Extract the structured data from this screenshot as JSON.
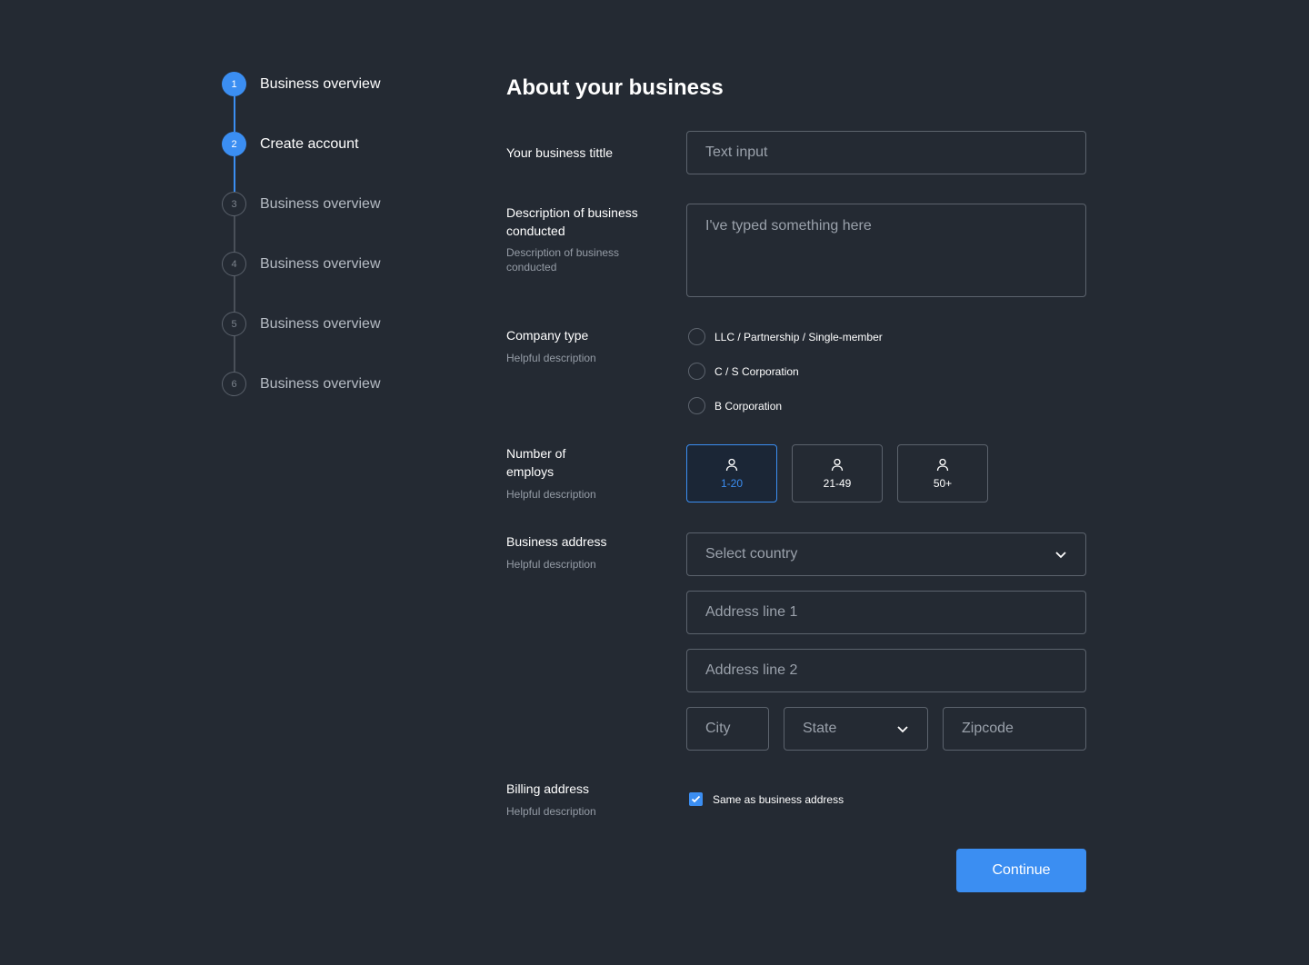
{
  "colors": {
    "background": "#242a33",
    "accent": "#3b8ef2",
    "border": "#5c636d",
    "placeholder": "#9aa1ab",
    "help_text": "#959ca6"
  },
  "stepper": {
    "steps": [
      {
        "number": "1",
        "label": "Business overview",
        "state": "active"
      },
      {
        "number": "2",
        "label": "Create account",
        "state": "active"
      },
      {
        "number": "3",
        "label": "Business overview",
        "state": "inactive"
      },
      {
        "number": "4",
        "label": "Business overview",
        "state": "inactive"
      },
      {
        "number": "5",
        "label": "Business overview",
        "state": "inactive"
      },
      {
        "number": "6",
        "label": "Business overview",
        "state": "inactive"
      }
    ]
  },
  "form": {
    "title": "About your business",
    "business_title": {
      "label": "Your business tittle",
      "placeholder": "Text input"
    },
    "description": {
      "label": "Description of business conducted",
      "help": "Description of business conducted",
      "value": "I've typed something here"
    },
    "company_type": {
      "label": "Company type",
      "help": "Helpful description",
      "options": [
        "LLC / Partnership / Single-member",
        "C / S Corporation",
        "B Corporation"
      ]
    },
    "employees": {
      "label": "Number of employs",
      "help": "Helpful description",
      "icon": "user-icon",
      "options": [
        "1-20",
        "21-49",
        "50+"
      ],
      "selected": "1-20"
    },
    "business_address": {
      "label": "Business address",
      "help": "Helpful description",
      "country_placeholder": "Select country",
      "line1_placeholder": "Address line 1",
      "line2_placeholder": "Address line 2",
      "city_placeholder": "City",
      "state_placeholder": "State",
      "zip_placeholder": "Zipcode"
    },
    "billing_address": {
      "label": "Billing address",
      "help": "Helpful description",
      "checkbox_label": "Same as business address",
      "checked": true
    },
    "continue_label": "Continue"
  }
}
